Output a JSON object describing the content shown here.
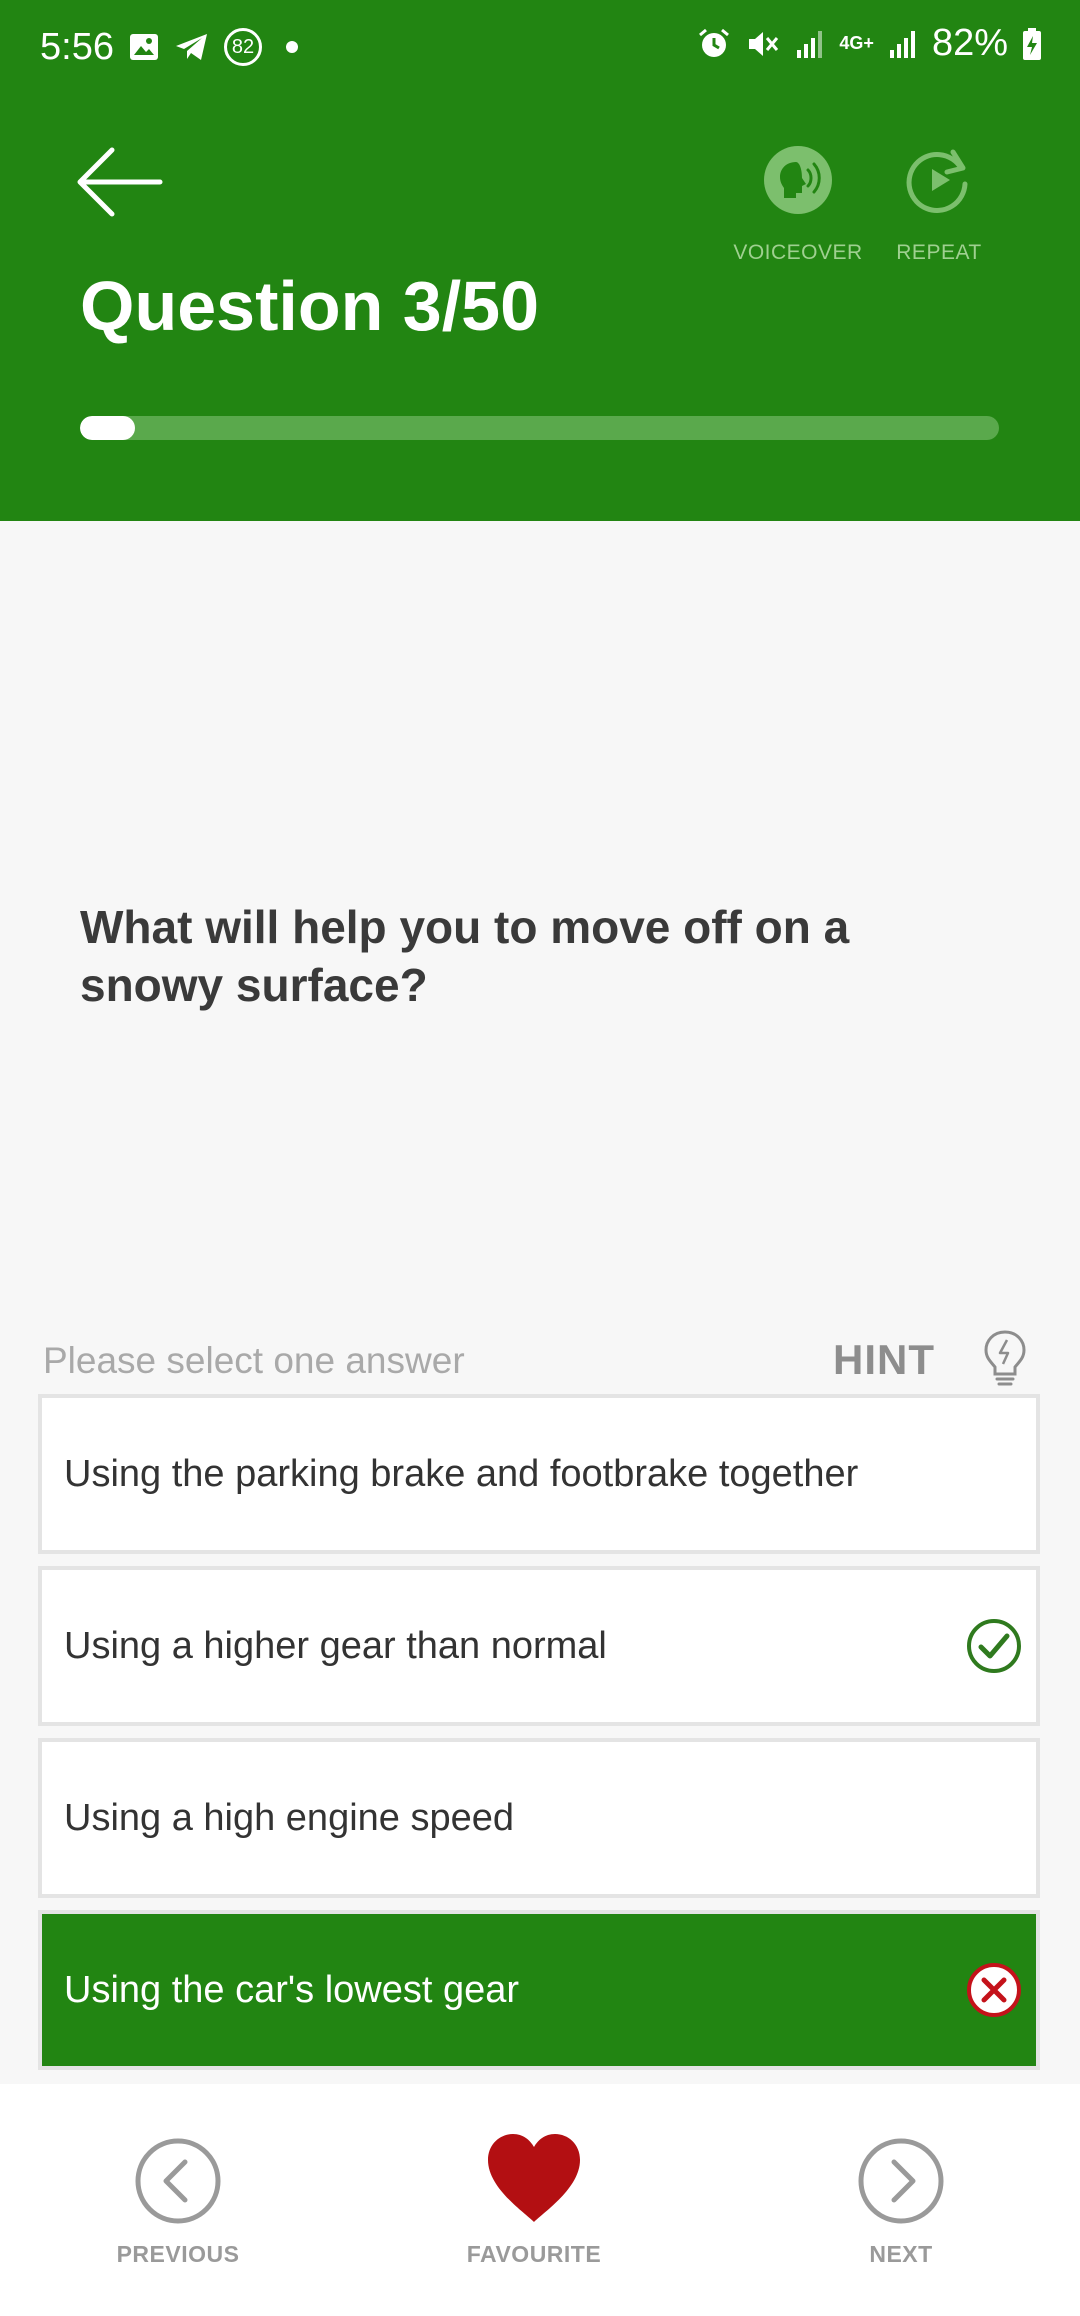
{
  "status_bar": {
    "time": "5:56",
    "notification_count": "82",
    "network": "4G+",
    "battery": "82%"
  },
  "header": {
    "question_counter": "Question 3/50",
    "voiceover_label": "VOICEOVER",
    "repeat_label": "REPEAT",
    "progress_fraction": 0.06
  },
  "question": {
    "text": "What will help you to move off on a snowy surface?",
    "prompt": "Please select one answer",
    "hint_label": "HINT"
  },
  "answers": [
    {
      "text": "Using the parking brake and footbrake together",
      "state": "none"
    },
    {
      "text": "Using a higher gear than normal",
      "state": "correct"
    },
    {
      "text": "Using a high engine speed",
      "state": "none"
    },
    {
      "text": "Using the car's lowest gear",
      "state": "wrong-selected"
    }
  ],
  "bottom_nav": {
    "previous_label": "PREVIOUS",
    "favourite_label": "FAVOURITE",
    "next_label": "NEXT"
  },
  "colors": {
    "brand_green": "#228512",
    "favourite_red": "#b30f12",
    "correct_green": "#2f7a1e",
    "wrong_red": "#c4121a"
  },
  "icons": {
    "back": "arrow-left-icon",
    "voiceover": "speaking-head-icon",
    "repeat": "replay-icon",
    "hint": "lightbulb-icon",
    "correct": "check-circle-icon",
    "wrong": "x-circle-icon",
    "previous": "chevron-left-circle-icon",
    "favourite": "heart-icon",
    "next": "chevron-right-circle-icon"
  }
}
